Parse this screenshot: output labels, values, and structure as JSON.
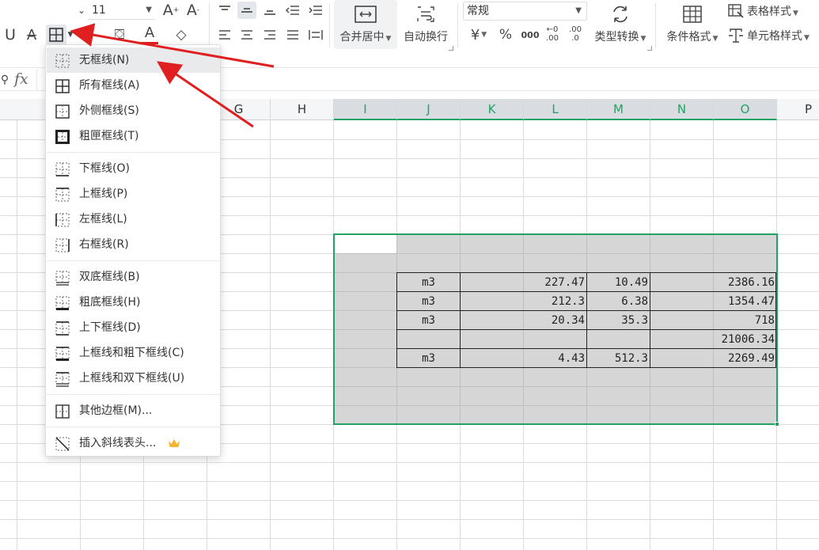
{
  "ribbon": {
    "font_size": "11",
    "number_format": "常规",
    "merge_center_label": "合并居中",
    "wrap_text_label": "自动换行",
    "type_convert_label": "类型转换",
    "cond_format_label": "条件格式",
    "table_style_label": "表格样式",
    "cell_style_label": "单元格样式",
    "currency_symbol": "¥",
    "percent_symbol": "%",
    "thousands_symbol": "000",
    "inc_decimal": ".00",
    "dec_decimal": ".0"
  },
  "formula_bar": {
    "fx_label": "fx",
    "value": ""
  },
  "columns": {
    "G": "G",
    "H": "H",
    "I": "I",
    "J": "J",
    "K": "K",
    "L": "L",
    "M": "M",
    "N": "N",
    "O": "O",
    "P": "P"
  },
  "table": {
    "rows": [
      {
        "unit": "m3",
        "l": "227.47",
        "m": "10.49",
        "o": "2386.16"
      },
      {
        "unit": "m3",
        "l": "212.3",
        "m": "6.38",
        "o": "1354.47"
      },
      {
        "unit": "m3",
        "l": "20.34",
        "m": "35.3",
        "o": "718"
      },
      {
        "unit": "",
        "l": "",
        "m": "",
        "o": "21006.34"
      },
      {
        "unit": "m3",
        "l": "4.43",
        "m": "512.3",
        "o": "2269.49"
      }
    ]
  },
  "border_menu": {
    "items": [
      {
        "label": "无框线(N)"
      },
      {
        "label": "所有框线(A)"
      },
      {
        "label": "外侧框线(S)"
      },
      {
        "label": "粗匣框线(T)"
      },
      {
        "label": "下框线(O)"
      },
      {
        "label": "上框线(P)"
      },
      {
        "label": "左框线(L)"
      },
      {
        "label": "右框线(R)"
      },
      {
        "label": "双底框线(B)"
      },
      {
        "label": "粗底框线(H)"
      },
      {
        "label": "上下框线(D)"
      },
      {
        "label": "上框线和粗下框线(C)"
      },
      {
        "label": "上框线和双下框线(U)"
      },
      {
        "label": "其他边框(M)..."
      },
      {
        "label": "插入斜线表头..."
      }
    ]
  },
  "colors": {
    "selection": "#21a366",
    "menu_highlight": "#e9eaec",
    "arrow": "#e02020",
    "crown": "#f5b52e"
  }
}
